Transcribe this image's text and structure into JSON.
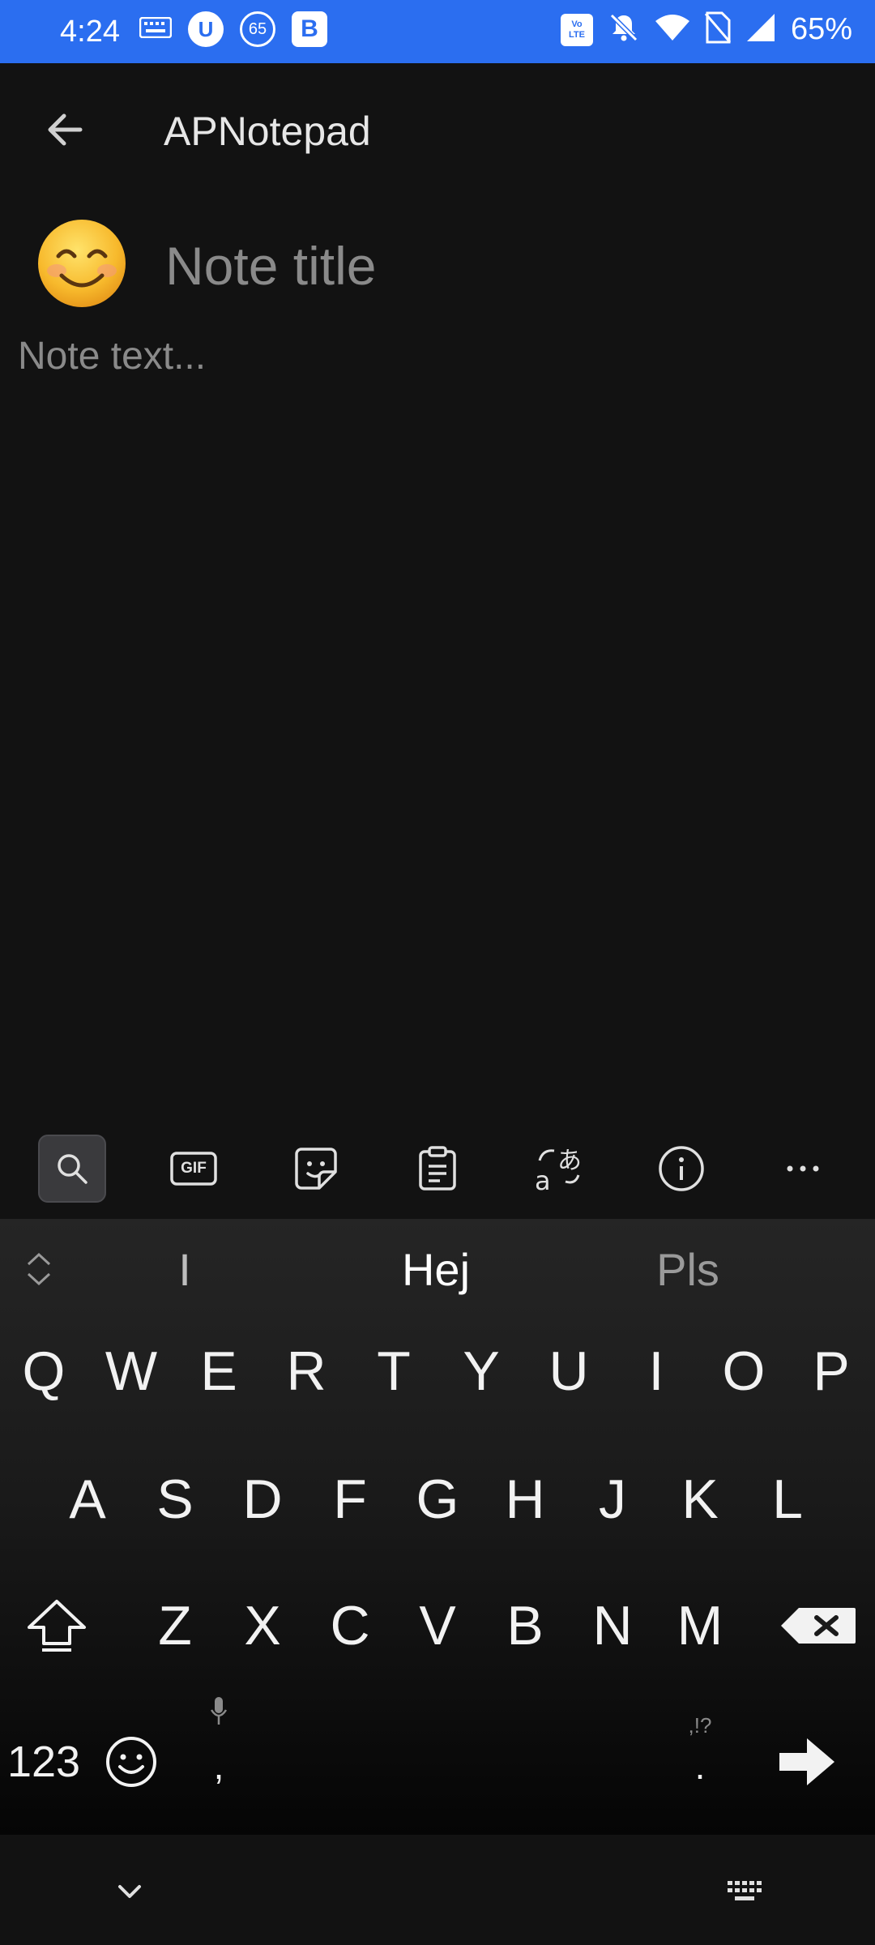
{
  "status_bar": {
    "time": "4:24",
    "left_icons": [
      "keyboard-icon",
      "u-circle-icon",
      "65-circle-icon",
      "b-square-icon"
    ],
    "circle_u": "U",
    "circle_65": "65",
    "square_b": "B",
    "volte_top": "Vo",
    "volte_bottom": "LTE",
    "battery": "65%"
  },
  "app_bar": {
    "title": "APNotepad"
  },
  "note": {
    "emoji": "😊",
    "title_placeholder": "Note title",
    "text_placeholder": "Note text..."
  },
  "keyboard": {
    "toolbar": [
      "search-icon",
      "gif-icon",
      "sticker-icon",
      "clipboard-icon",
      "translate-icon",
      "info-icon",
      "more-icon"
    ],
    "gif_label": "GIF",
    "suggestions": [
      "I",
      "Hej",
      "Pls"
    ],
    "rows": [
      [
        "Q",
        "W",
        "E",
        "R",
        "T",
        "Y",
        "U",
        "I",
        "O",
        "P"
      ],
      [
        "A",
        "S",
        "D",
        "F",
        "G",
        "H",
        "J",
        "K",
        "L"
      ],
      [
        "Z",
        "X",
        "C",
        "V",
        "B",
        "N",
        "M"
      ]
    ],
    "numbers_label": "123",
    "comma": ",",
    "period": ".",
    "punct_hint": ",!?"
  }
}
